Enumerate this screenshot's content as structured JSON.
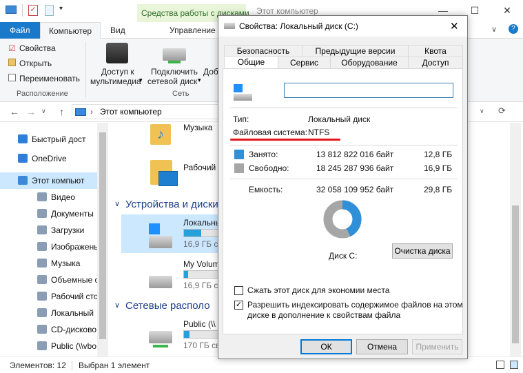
{
  "explorer": {
    "context_tab": "Средства работы с дисками",
    "window_title": "Этот компьютер",
    "tabs": {
      "file": "Файл",
      "computer": "Компьютер",
      "view": "Вид",
      "manage": "Управление"
    },
    "ribbon": {
      "properties": "Свойства",
      "open": "Открыть",
      "rename": "Переименовать",
      "group_location": "Расположение",
      "media_access_1": "Доступ к",
      "media_access_2": "мультимедиа",
      "map_drive_1": "Подключить",
      "map_drive_2": "сетевой диск",
      "add_cut": "Доб",
      "group_network": "Сеть"
    },
    "address": "Этот компьютер",
    "nav": [
      {
        "label": "Быстрый дост",
        "icon": "star-icon"
      },
      {
        "label": "OneDrive",
        "icon": "cloud-icon"
      },
      {
        "label": "Этот компьют",
        "icon": "computer-icon"
      },
      {
        "label": "Видео",
        "icon": "video-icon"
      },
      {
        "label": "Документы",
        "icon": "documents-icon"
      },
      {
        "label": "Загрузки",
        "icon": "downloads-icon"
      },
      {
        "label": "Изображень",
        "icon": "pictures-icon"
      },
      {
        "label": "Музыка",
        "icon": "music-icon"
      },
      {
        "label": "Объемные о",
        "icon": "3d-objects-icon"
      },
      {
        "label": "Рабочий сто",
        "icon": "desktop-icon"
      },
      {
        "label": "Локальный",
        "icon": "drive-icon"
      },
      {
        "label": "CD-дисково",
        "icon": "cd-drive-icon"
      },
      {
        "label": "Public (\\\\vbo",
        "icon": "network-drive-icon"
      }
    ],
    "content": {
      "music": "Музыка",
      "desktop": "Рабочий",
      "devices_header": "Устройства и диски",
      "local_name": "Локальны",
      "local_free": "16,9 ГБ св",
      "myvol_name": "My Volum",
      "myvol_free": "16,9 ГБ св",
      "net_header": "Сетевые располо",
      "public_name": "Public (\\\\",
      "public_free": "170 ГБ св"
    },
    "status": {
      "items": "Элементов: 12",
      "selected": "Выбран 1 элемент"
    }
  },
  "dialog": {
    "title": "Свойства: Локальный диск (C:)",
    "tabs_row1": [
      "Безопасность",
      "Предыдущие версии",
      "Квота"
    ],
    "tabs_row2": [
      "Общие",
      "Сервис",
      "Оборудование",
      "Доступ"
    ],
    "name_value": "",
    "type_label": "Тип:",
    "type_value": "Локальный диск",
    "fs_label": "Файловая система:",
    "fs_value": "NTFS",
    "used_label": "Занято:",
    "used_bytes": "13 812 822 016 байт",
    "used_gb": "12,8 ГБ",
    "free_label": "Свободно:",
    "free_bytes": "18 245 287 936 байт",
    "free_gb": "16,9 ГБ",
    "cap_label": "Емкость:",
    "cap_bytes": "32 058 109 952 байт",
    "cap_gb": "29,8 ГБ",
    "used_fraction": 0.431,
    "disk_label": "Диск C:",
    "cleanup_button": "Очистка диска",
    "compress_label": "Сжать этот диск для экономии места",
    "compress_checked": false,
    "index_label_1": "Разрешить индексировать содержимое файлов на этом",
    "index_label_2": "диске в дополнение к свойствам файла",
    "index_checked": true,
    "ok": "ОК",
    "cancel": "Отмена",
    "apply": "Применить"
  },
  "colors": {
    "used": "#2f8fd8",
    "free": "#a6a6a6",
    "accent": "#0078d7",
    "underline": "#e8141c"
  }
}
